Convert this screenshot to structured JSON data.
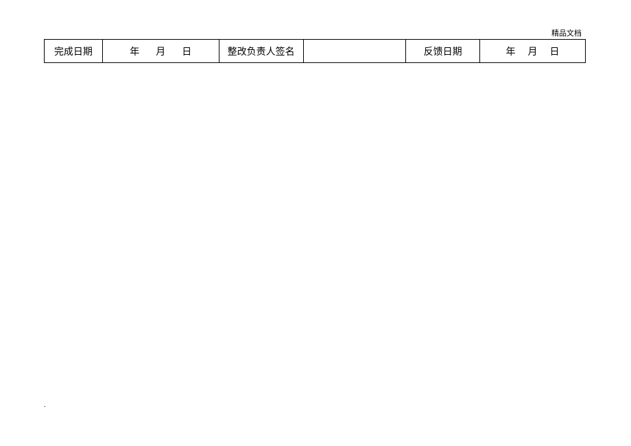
{
  "header": {
    "watermark": "精品文档"
  },
  "table": {
    "row": {
      "completion_date_label": "完成日期",
      "completion_date_value": {
        "year": "年",
        "month": "月",
        "day": "日"
      },
      "signer_label": "整改负责人签名",
      "signer_value": "",
      "feedback_date_label": "反馈日期",
      "feedback_date_value": {
        "year": "年",
        "month": "月",
        "day": "日"
      }
    }
  },
  "footer": {
    "mark": "."
  }
}
